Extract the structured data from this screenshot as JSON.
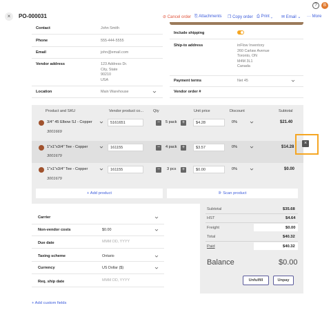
{
  "header": {
    "order_number": "PO-000031",
    "actions": {
      "cancel": "Cancel order",
      "attachments": "Attachments",
      "copy": "Copy order",
      "print": "Print",
      "email": "Email",
      "more": "More"
    },
    "avatar_initial": "B"
  },
  "vendor": {
    "contact_label": "Contact",
    "contact": "John Smith",
    "phone_label": "Phone",
    "phone": "555-444-5555",
    "email_label": "Email",
    "email": "john@email.com",
    "address_label": "Vendor address",
    "address_lines": [
      "123 Address Dr.",
      "City, State",
      "90210",
      "USA"
    ],
    "location_label": "Location",
    "location": "Main Warehouse"
  },
  "shipping": {
    "include_label": "Include shipping",
    "ship_to_label": "Ship-to address",
    "ship_to_lines": [
      "inFlow Inventory",
      "260 Carlaw Avenue",
      "Toronto, ON",
      "M4M 3L1",
      "Canada"
    ],
    "payment_terms_label": "Payment terms",
    "payment_terms": "Net 45",
    "vendor_order_label": "Vendor order #"
  },
  "items_table": {
    "headers": [
      "Product and SKU",
      "Vendor product co...",
      "Qty",
      "Unit price",
      "Discount",
      "Subtotal"
    ],
    "rows": [
      {
        "product": "3/4\" 45 Elbow SJ - Copper",
        "sku": "3001669",
        "vendor_code": "5161651",
        "qty": "5 pack",
        "price": "$4.28",
        "discount": "0%",
        "subtotal": "$21.40"
      },
      {
        "product": "1\"x1\"x3/4\" Tee - Copper",
        "sku": "3001679",
        "vendor_code": "161155",
        "qty": "4 pack",
        "price": "$3.57",
        "discount": "0%",
        "subtotal": "$14.28"
      },
      {
        "product": "1\"x1\"x3/4\" Tee - Copper",
        "sku": "3001679",
        "vendor_code": "161155",
        "qty": "3 pcs",
        "price": "$0.00",
        "discount": "0%",
        "subtotal": "$0.00"
      }
    ],
    "add_product": "+ Add product",
    "scan_product": "Scan product"
  },
  "details": {
    "carrier_label": "Carrier",
    "non_vendor_label": "Non-vendor costs",
    "non_vendor": "$0.00",
    "due_label": "Due date",
    "due_placeholder": "MMM DD, YYYY",
    "taxing_label": "Taxing scheme",
    "taxing": "Ontario",
    "currency_label": "Currency",
    "currency": "US Dollar ($)",
    "req_ship_label": "Req. ship date",
    "req_ship_placeholder": "MMM DD, YYYY"
  },
  "totals": {
    "subtotal_label": "Subtotal",
    "subtotal": "$35.68",
    "hst_label": "HST",
    "hst": "$4.64",
    "freight_label": "Freight",
    "freight": "$0.00",
    "total_label": "Total",
    "total": "$40.32",
    "paid_label": "Paid",
    "paid": "$40.32",
    "balance_label": "Balance",
    "balance": "$0.00",
    "unfulfill": "Unfulfill",
    "unpay": "Unpay"
  },
  "footer": {
    "add_custom_fields": "+ Add custom fields"
  },
  "colors": {
    "accent": "#f5a623",
    "danger": "#e0533a",
    "brand": "#3b5bdb",
    "product_dot": "#a0522d"
  }
}
